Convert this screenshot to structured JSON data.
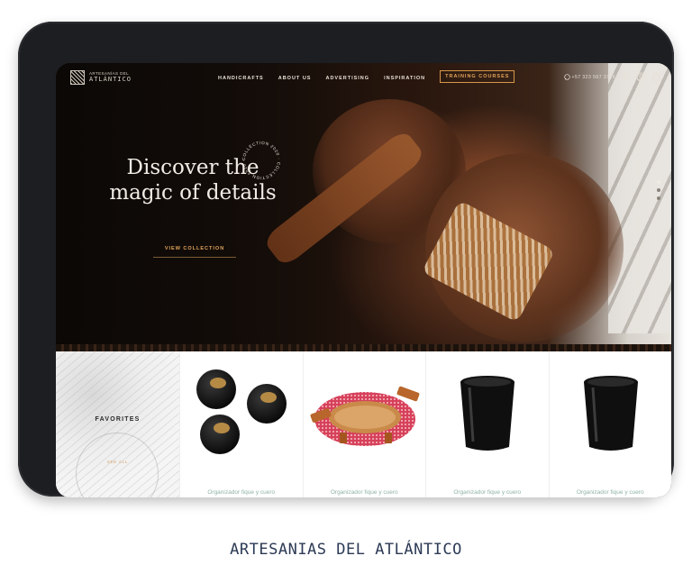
{
  "brand": {
    "line1": "ARTESANÍAS DEL",
    "line2": "ATLÁNTICO"
  },
  "nav": {
    "items": [
      {
        "label": "HANDICRAFTS"
      },
      {
        "label": "ABOUT US"
      },
      {
        "label": "ADVERTISING"
      },
      {
        "label": "INSPIRATION"
      }
    ],
    "cta": "TRAINING COURSES",
    "phone": "+57 323 567 3718",
    "icons": [
      "whatsapp-icon",
      "search-icon",
      "user-icon",
      "bag-icon"
    ]
  },
  "hero": {
    "title_line1": "Discover the",
    "title_line2": "magic of details",
    "badge_text": "COLLECTION 2020 · COLLECTION 2020 ·",
    "cta": "VIEW COLLECTION",
    "slider_dots": 3,
    "active_dot": 1
  },
  "favorites": {
    "title": "FAVORITES",
    "link": "SEE ALL"
  },
  "products": [
    {
      "name": "Organizador fique y cuero",
      "image": "black-spheres"
    },
    {
      "name": "Organizador fique y cuero",
      "image": "woven-basket"
    },
    {
      "name": "Organizador fique y cuero",
      "image": "black-cup"
    },
    {
      "name": "Organizador fique y cuero",
      "image": "black-cup"
    }
  ],
  "caption": "ARTESANIAS DEL ATLÁNTICO",
  "colors": {
    "accent": "#e3a45a",
    "product_text": "#8fb2a6",
    "caption": "#2c3a55"
  }
}
